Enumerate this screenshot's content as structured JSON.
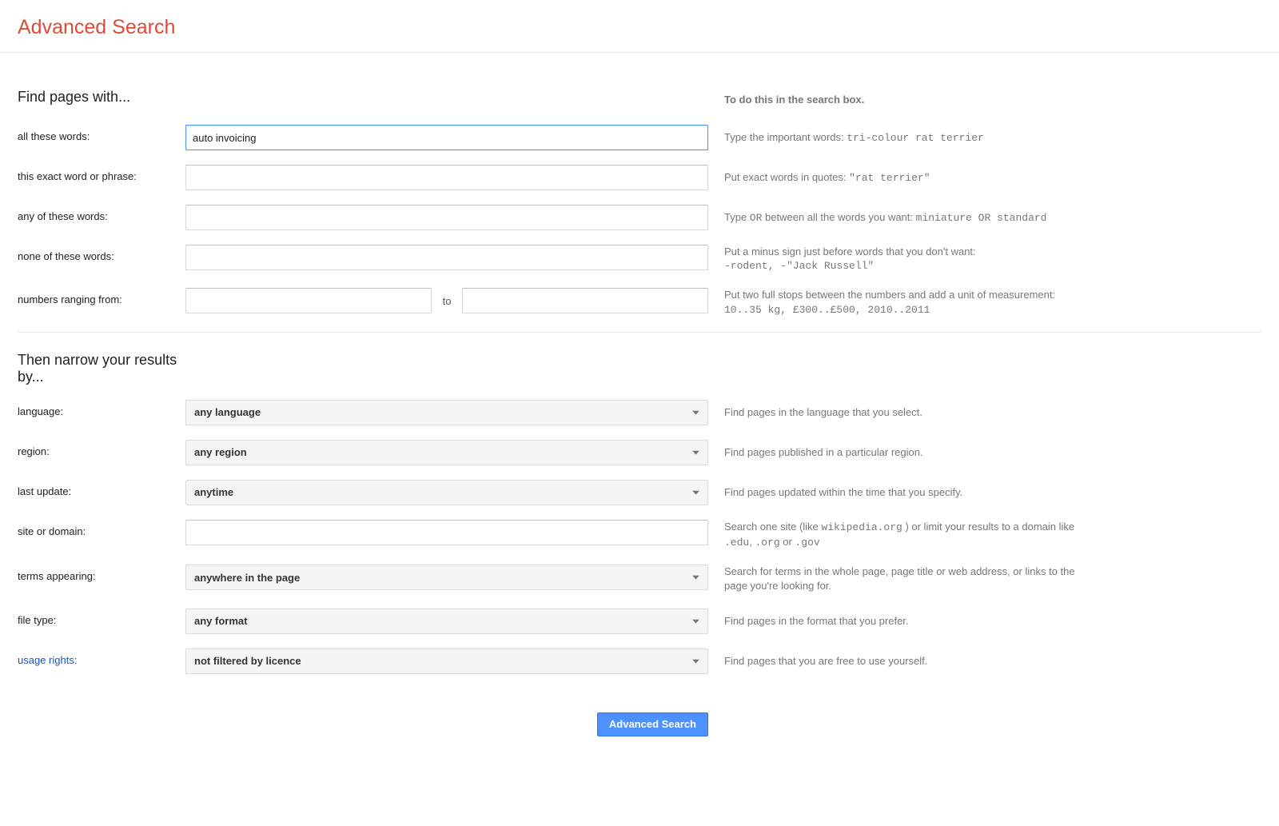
{
  "title": "Advanced Search",
  "find": {
    "heading": "Find pages with...",
    "hint_heading": "To do this in the search box.",
    "all_words": {
      "label": "all these words:",
      "value": "auto invoicing",
      "hint_prefix": "Type the important words: ",
      "hint_code": "tri-colour rat terrier"
    },
    "exact_phrase": {
      "label": "this exact word or phrase:",
      "value": "",
      "hint_prefix": "Put exact words in quotes: ",
      "hint_code": "\"rat terrier\""
    },
    "any_words": {
      "label": "any of these words:",
      "value": "",
      "hint_prefix": "Type ",
      "hint_code1": "OR",
      "hint_mid": " between all the words you want: ",
      "hint_code2": "miniature OR standard"
    },
    "none_words": {
      "label": "none of these words:",
      "value": "",
      "hint_line1": "Put a minus sign just before words that you don't want:",
      "hint_code": "-rodent, -\"Jack Russell\""
    },
    "numbers": {
      "label": "numbers ranging from:",
      "from_value": "",
      "to_label": "to",
      "to_value": "",
      "hint_line1": "Put two full stops between the numbers and add a unit of measurement:",
      "hint_code": "10..35 kg, £300..£500, 2010..2011"
    }
  },
  "narrow": {
    "heading": "Then narrow your results by...",
    "language": {
      "label": "language:",
      "value": "any language",
      "hint": "Find pages in the language that you select."
    },
    "region": {
      "label": "region:",
      "value": "any region",
      "hint": "Find pages published in a particular region."
    },
    "last_update": {
      "label": "last update:",
      "value": "anytime",
      "hint": "Find pages updated within the time that you specify."
    },
    "site": {
      "label": "site or domain:",
      "value": "",
      "hint_prefix": "Search one site (like ",
      "hint_code1": "wikipedia.org",
      "hint_mid": " ) or limit your results to a domain like ",
      "hint_code2": ".edu",
      "hint_sep1": ", ",
      "hint_code3": ".org",
      "hint_sep2": " or ",
      "hint_code4": ".gov"
    },
    "terms": {
      "label": "terms appearing:",
      "value": "anywhere in the page",
      "hint": "Search for terms in the whole page, page title or web address, or links to the page you're looking for."
    },
    "filetype": {
      "label": "file type:",
      "value": "any format",
      "hint": "Find pages in the format that you prefer."
    },
    "rights": {
      "label": "usage rights:",
      "value": "not filtered by licence",
      "hint": "Find pages that you are free to use yourself."
    }
  },
  "submit_label": "Advanced Search"
}
